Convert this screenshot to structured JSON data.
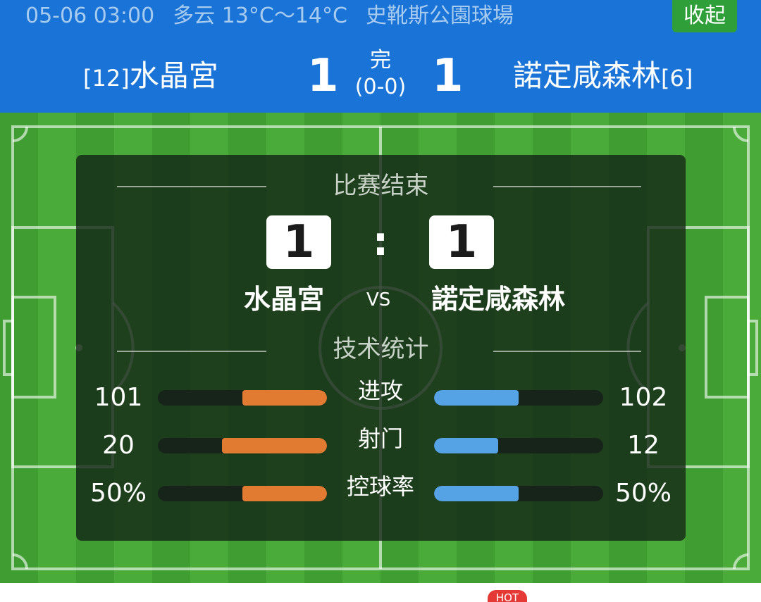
{
  "header": {
    "datetime": "05-06 03:00",
    "weather": "多云 13°C～14°C",
    "venue": "史靴斯公園球場",
    "collapse_label": "收起",
    "home": {
      "rank": "[12]",
      "name": "水晶宮",
      "score": "1"
    },
    "away": {
      "name": "諾定咸森林",
      "rank": "[6]",
      "score": "1"
    },
    "status": "完",
    "halftime": "(0-0)"
  },
  "panel": {
    "result_title": "比赛结束",
    "home_score": "1",
    "separator": ":",
    "away_score": "1",
    "home_team": "水晶宮",
    "vs_label": "VS",
    "away_team": "諾定咸森林",
    "stats_title": "技术统计",
    "stats": [
      {
        "label": "进攻",
        "home": "101",
        "away": "102",
        "home_share": 0.5,
        "away_share": 0.5
      },
      {
        "label": "射门",
        "home": "20",
        "away": "12",
        "home_share": 0.62,
        "away_share": 0.38
      },
      {
        "label": "控球率",
        "home": "50%",
        "away": "50%",
        "home_share": 0.5,
        "away_share": 0.5
      }
    ]
  },
  "badge": {
    "hot_label": "HOT"
  },
  "colors": {
    "header_bg": "#1a73d6",
    "collapse_bg": "#2fa039",
    "home_bar": "#e27b32",
    "away_bar": "#55a3e4",
    "hot_badge": "#e53935"
  }
}
